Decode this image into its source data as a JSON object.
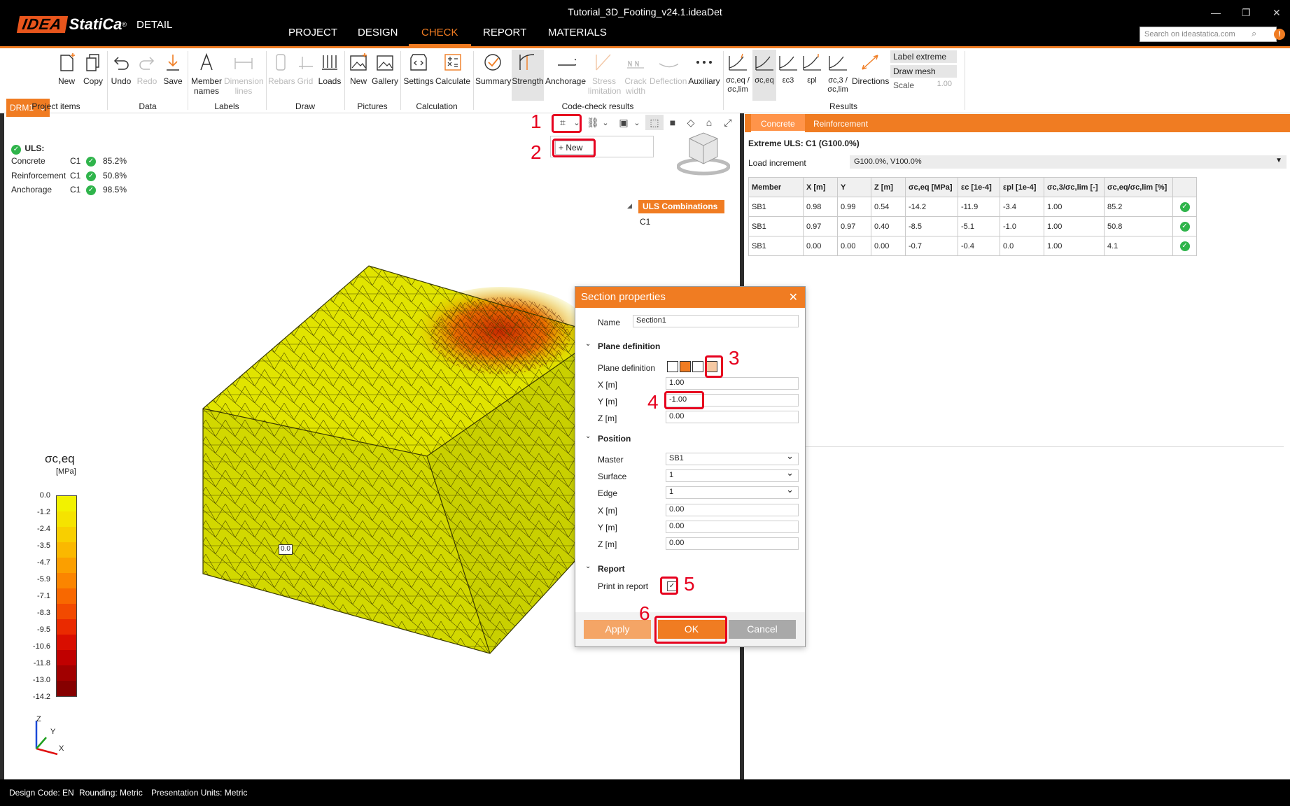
{
  "app": {
    "brand_idea": "IDEA",
    "brand_statica": "StatiCa",
    "brand_mark": "®",
    "product": "DETAIL",
    "doc_title": "Tutorial_3D_Footing_v24.1.ideaDet"
  },
  "menu": [
    "PROJECT",
    "DESIGN",
    "CHECK",
    "REPORT",
    "MATERIALS"
  ],
  "search": {
    "placeholder": "Search on ideastatica.com"
  },
  "ribbon": {
    "drm": "DRM1",
    "project_items": {
      "new": "New",
      "copy": "Copy",
      "group": "Project items"
    },
    "data": {
      "undo": "Undo",
      "redo": "Redo",
      "save": "Save",
      "group": "Data"
    },
    "labels": {
      "member_names": "Member names",
      "dimension_lines": "Dimension lines",
      "group": "Labels"
    },
    "draw": {
      "rebars": "Rebars",
      "grid": "Grid",
      "loads": "Loads",
      "group": "Draw"
    },
    "pictures": {
      "new": "New",
      "gallery": "Gallery",
      "group": "Pictures"
    },
    "calculation": {
      "settings": "Settings",
      "calculate": "Calculate",
      "group": "Calculation"
    },
    "code_check": {
      "summary": "Summary",
      "strength": "Strength",
      "anchorage": "Anchorage",
      "stress_limitation": "Stress limitation",
      "crack_width": "Crack width",
      "deflection": "Deflection",
      "auxiliary": "Auxiliary",
      "group": "Code-check results"
    },
    "results": {
      "r1": "σc,eq / σc,lim",
      "r2": "σc,eq",
      "r3": "εc3",
      "r4": "εpl",
      "r5": "σc,3 / σc,lim",
      "r6": "Directions",
      "label_extreme": "Label extreme",
      "draw_mesh": "Draw mesh",
      "scale_label": "Scale",
      "scale_value": "1.00",
      "group": "Results"
    }
  },
  "viewport": {
    "new_button": "New",
    "uls_title": "ULS:",
    "uls_rows": [
      {
        "name": "Concrete",
        "comb": "C1",
        "value": "85.2%"
      },
      {
        "name": "Reinforcement",
        "comb": "C1",
        "value": "50.8%"
      },
      {
        "name": "Anchorage",
        "comb": "C1",
        "value": "98.5%"
      }
    ],
    "tree_header": "ULS Combinations",
    "tree_item": "C1",
    "label_value": "0.0",
    "legend_title": "σc,eq",
    "legend_unit": "[MPa]",
    "legend_values": [
      "0.0",
      "-1.2",
      "-2.4",
      "-3.5",
      "-4.7",
      "-5.9",
      "-7.1",
      "-8.3",
      "-9.5",
      "-10.6",
      "-11.8",
      "-13.0",
      "-14.2"
    ],
    "legend_colors": [
      "#f2f200",
      "#f5e300",
      "#f8cf00",
      "#fab800",
      "#fb9f00",
      "#fb8500",
      "#f86800",
      "#f24a00",
      "#ea2a00",
      "#d90e00",
      "#c00000",
      "#a10000",
      "#860000"
    ],
    "axis": {
      "z": "Z",
      "y": "Y",
      "x": "X"
    }
  },
  "annotations": [
    "1",
    "2",
    "3",
    "4",
    "5",
    "6"
  ],
  "right_panel": {
    "tabs": [
      "Concrete",
      "Reinforcement"
    ],
    "extreme": "Extreme ULS: C1 (G100.0%)",
    "load_increment_label": "Load increment",
    "load_increment_value": "G100.0%, V100.0%",
    "table": {
      "headers": [
        "Member",
        "X [m]",
        "Y",
        "Z [m]",
        "σc,eq [MPa]",
        "εc [1e-4]",
        "εpl [1e-4]",
        "σc,3/σc,lim [-]",
        "σc,eq/σc,lim [%]",
        ""
      ],
      "rows": [
        [
          "SB1",
          "0.98",
          "0.99",
          "0.54",
          "-14.2",
          "-11.9",
          "-3.4",
          "1.00",
          "85.2"
        ],
        [
          "SB1",
          "0.97",
          "0.97",
          "0.40",
          "-8.5",
          "-5.1",
          "-1.0",
          "1.00",
          "50.8"
        ],
        [
          "SB1",
          "0.00",
          "0.00",
          "0.00",
          "-0.7",
          "-0.4",
          "0.0",
          "1.00",
          "4.1"
        ]
      ]
    }
  },
  "dialog": {
    "title": "Section properties",
    "name_label": "Name",
    "name_value": "Section1",
    "plane_section": "Plane definition",
    "plane_def_label": "Plane definition",
    "x_label": "X [m]",
    "x_value": "1.00",
    "y_label": "Y [m]",
    "y_value": "-1.00",
    "z_label": "Z [m]",
    "z_value": "0.00",
    "position_section": "Position",
    "master_label": "Master",
    "master_value": "SB1",
    "surface_label": "Surface",
    "surface_value": "1",
    "edge_label": "Edge",
    "edge_value": "1",
    "px_label": "X [m]",
    "px_value": "0.00",
    "py_label": "Y [m]",
    "py_value": "0.00",
    "pz_label": "Z [m]",
    "pz_value": "0.00",
    "report_section": "Report",
    "print_label": "Print in report",
    "apply": "Apply",
    "ok": "OK",
    "cancel": "Cancel"
  },
  "status": {
    "design_code": "Design Code: EN",
    "rounding": "Rounding: Metric",
    "units": "Presentation Units: Metric"
  },
  "colors": {
    "accent": "#f07c22",
    "pass": "#2fb44b",
    "annotation": "#e6001e"
  }
}
